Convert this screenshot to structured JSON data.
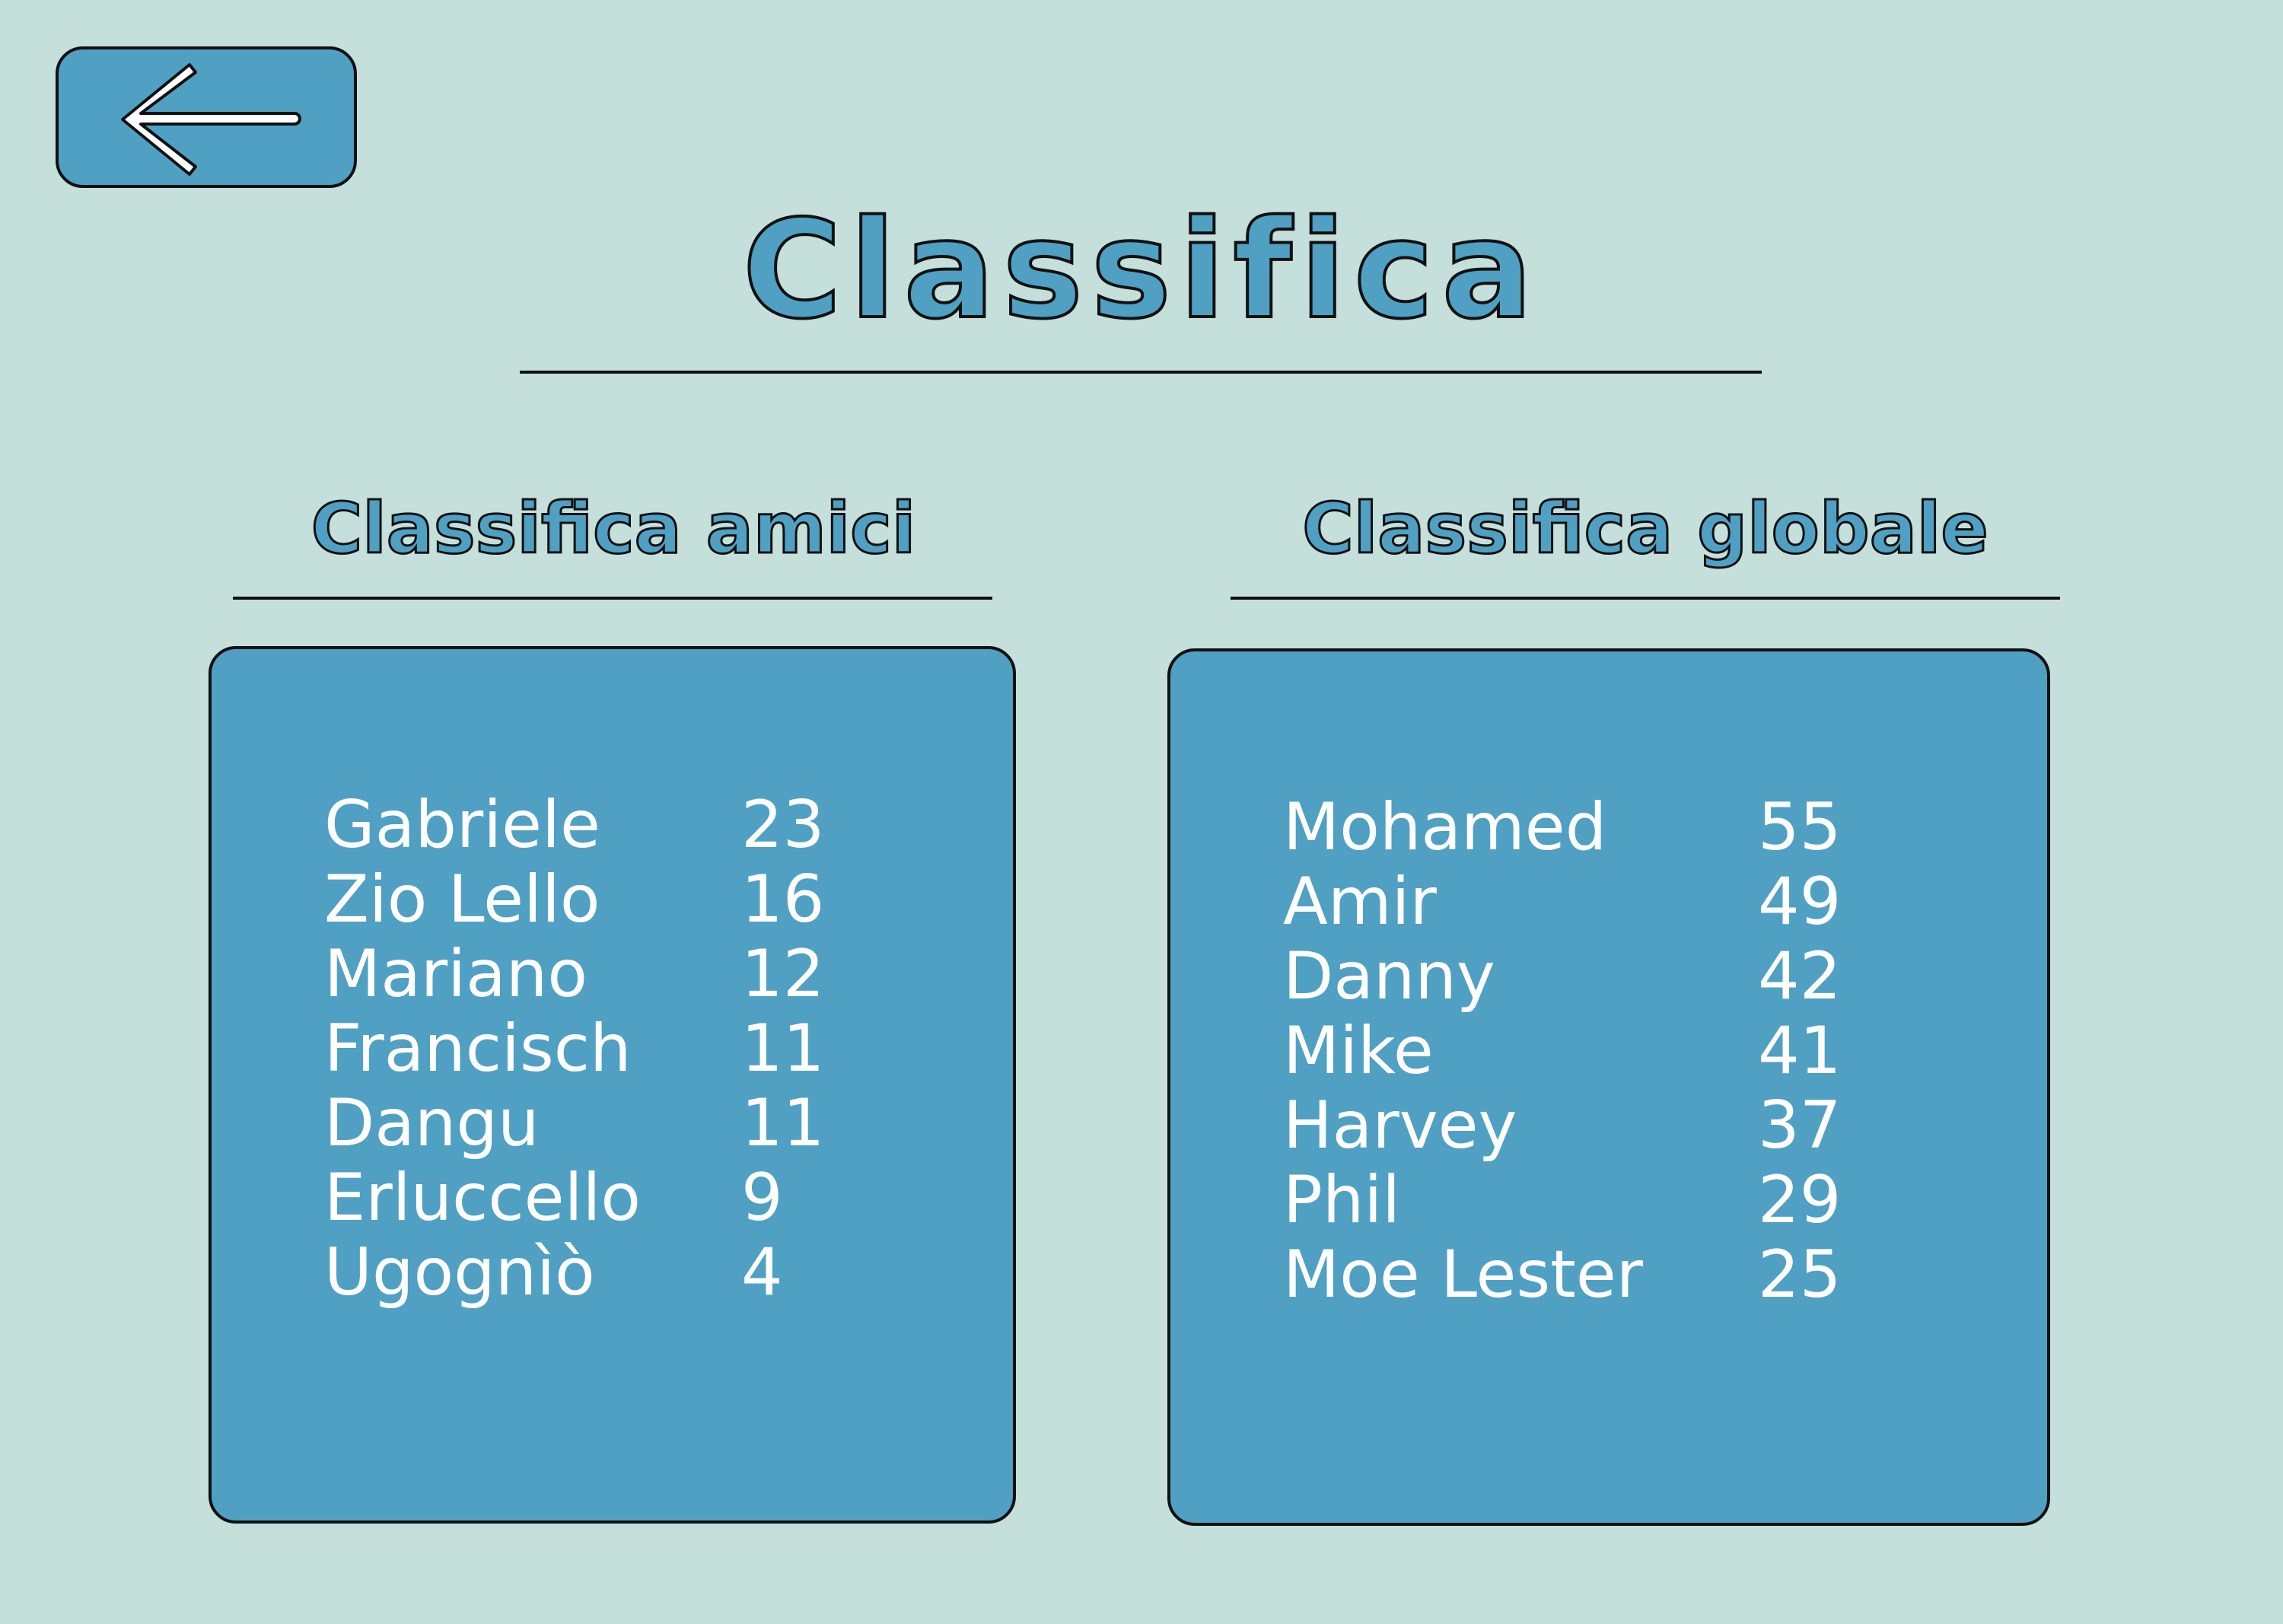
{
  "page": {
    "title": "Classifica",
    "back_icon": "arrow-left-icon"
  },
  "colors": {
    "background": "#c5dfdb",
    "accent": "#50a0c3",
    "text_on_accent": "#ffffff",
    "outline": "#111111"
  },
  "friends": {
    "title": "Classifica amici",
    "entries": [
      {
        "name": "Gabriele",
        "score": "23"
      },
      {
        "name": "Zio Lello",
        "score": "16"
      },
      {
        "name": "Mariano",
        "score": "12"
      },
      {
        "name": "Francisch",
        "score": "11"
      },
      {
        "name": "Dangu",
        "score": "11"
      },
      {
        "name": "Erluccello",
        "score": "9"
      },
      {
        "name": "Ugognìò",
        "score": "4"
      }
    ]
  },
  "global": {
    "title": "Classifica globale",
    "entries": [
      {
        "name": "Mohamed",
        "score": "55"
      },
      {
        "name": "Amir",
        "score": "49"
      },
      {
        "name": "Danny",
        "score": "42"
      },
      {
        "name": "Mike",
        "score": "41"
      },
      {
        "name": "Harvey",
        "score": "37"
      },
      {
        "name": "Phil",
        "score": "29"
      },
      {
        "name": "Moe Lester",
        "score": "25"
      }
    ]
  }
}
